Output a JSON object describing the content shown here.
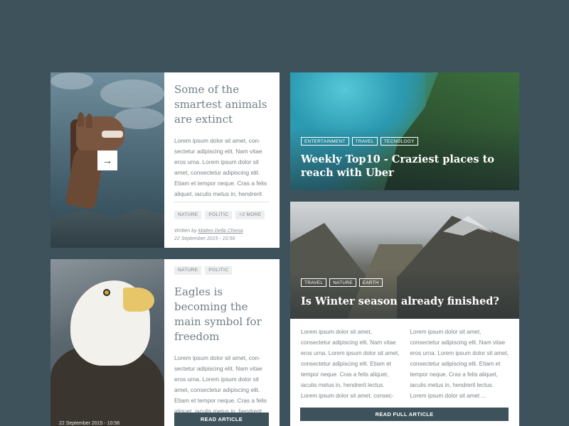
{
  "cards": [
    {
      "title": "Some of the smartest animals are extinct",
      "excerpt": "Lorem ipsum dolor sit amet, con-sectetur adipiscing elit. Nam vitae eros urna. Lorem ipsum dolor sit amet, consectetur adipiscing elit. Etiam et tempor neque. Cras a felis aliquet, iaculis metus in, hendrerit",
      "tags": [
        "NATURE",
        "POLITIC",
        "+2 MORE"
      ],
      "byline_prefix": "Written by",
      "author": "Matteo Della Chiesa",
      "date": "22 September 2015 - 10:56",
      "next_icon": "arrow-right-icon",
      "next_glyph": "→"
    },
    {
      "tags": [
        "NATURE",
        "POLITIC"
      ],
      "title": "Eagles is becoming the main symbol for freedom",
      "excerpt": "Lorem ipsum dolor sit amet, con-sectetur adipiscing elit. Nam vitae eros urna. Lorem ipsum dolor sit amet, consectetur adipiscing elit. Etiam et tempor neque. Cras a felis aliquet, iaculis metus in, hendrerit lectus.",
      "date": "22 September 2015 - 10:56",
      "button": "READ ARTICLE"
    },
    {
      "tags": [
        "ENTERTAINMENT",
        "TRAVEL",
        "TECNOLOGY"
      ],
      "title": "Weekly Top10 - Craziest places to reach with Uber"
    },
    {
      "tags": [
        "TRAVEL",
        "NATURE",
        "EARTH"
      ],
      "title": "Is Winter season already finished?",
      "col1": "Lorem ipsum dolor sit amet, consectetur adipiscing elit. Nam vitae eros urna. Lorem ipsum dolor sit amet, consectetur adipiscing elit. Etiam et tempor neque. Cras a felis aliquet, iaculis metus in, hendrerit lectus. Lorem ipsum dolor sit amet, consec-",
      "col2": "Lorem ipsum dolor sit amet, consectetur adipiscing elit. Nam vitae eros urna. Lorem ipsum dolor sit amet, consectetur adipiscing elit. Etiam et tempor neque. Cras a felis aliquet, iaculis metus in, hendrerit lectus. Lorem ipsum dolor sit amet ...",
      "button": "READ FULL ARTICLE"
    }
  ],
  "colors": {
    "background": "#3e525c",
    "card": "#ffffff",
    "accent": "#3e525c",
    "title_text": "#6e7e85",
    "body_text": "#7a8286",
    "tag_bg": "#eceeef"
  }
}
